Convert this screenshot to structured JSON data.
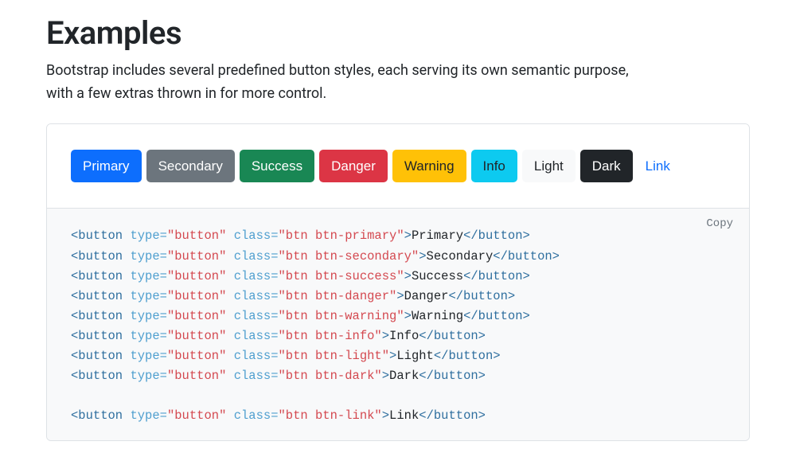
{
  "heading": "Examples",
  "intro": "Bootstrap includes several predefined button styles, each serving its own semantic purpose, with a few extras thrown in for more control.",
  "copy_label": "Copy",
  "buttons": [
    {
      "key": "primary",
      "label": "Primary",
      "class": "btn-primary",
      "bg": "#0d6efd",
      "fg": "#ffffff"
    },
    {
      "key": "secondary",
      "label": "Secondary",
      "class": "btn-secondary",
      "bg": "#6c757d",
      "fg": "#ffffff"
    },
    {
      "key": "success",
      "label": "Success",
      "class": "btn-success",
      "bg": "#198754",
      "fg": "#ffffff"
    },
    {
      "key": "danger",
      "label": "Danger",
      "class": "btn-danger",
      "bg": "#dc3545",
      "fg": "#ffffff"
    },
    {
      "key": "warning",
      "label": "Warning",
      "class": "btn-warning",
      "bg": "#ffc107",
      "fg": "#212529"
    },
    {
      "key": "info",
      "label": "Info",
      "class": "btn-info",
      "bg": "#0dcaf0",
      "fg": "#212529"
    },
    {
      "key": "light",
      "label": "Light",
      "class": "btn-light",
      "bg": "#f8f9fa",
      "fg": "#212529"
    },
    {
      "key": "dark",
      "label": "Dark",
      "class": "btn-dark",
      "bg": "#212529",
      "fg": "#ffffff"
    },
    {
      "key": "link",
      "label": "Link",
      "class": "btn-link",
      "bg": "transparent",
      "fg": "#0d6efd"
    }
  ],
  "code_lines": [
    {
      "tag": "button",
      "attrs": [
        {
          "name": "type",
          "value": "button"
        },
        {
          "name": "class",
          "value": "btn btn-primary"
        }
      ],
      "text": "Primary"
    },
    {
      "tag": "button",
      "attrs": [
        {
          "name": "type",
          "value": "button"
        },
        {
          "name": "class",
          "value": "btn btn-secondary"
        }
      ],
      "text": "Secondary"
    },
    {
      "tag": "button",
      "attrs": [
        {
          "name": "type",
          "value": "button"
        },
        {
          "name": "class",
          "value": "btn btn-success"
        }
      ],
      "text": "Success"
    },
    {
      "tag": "button",
      "attrs": [
        {
          "name": "type",
          "value": "button"
        },
        {
          "name": "class",
          "value": "btn btn-danger"
        }
      ],
      "text": "Danger"
    },
    {
      "tag": "button",
      "attrs": [
        {
          "name": "type",
          "value": "button"
        },
        {
          "name": "class",
          "value": "btn btn-warning"
        }
      ],
      "text": "Warning"
    },
    {
      "tag": "button",
      "attrs": [
        {
          "name": "type",
          "value": "button"
        },
        {
          "name": "class",
          "value": "btn btn-info"
        }
      ],
      "text": "Info"
    },
    {
      "tag": "button",
      "attrs": [
        {
          "name": "type",
          "value": "button"
        },
        {
          "name": "class",
          "value": "btn btn-light"
        }
      ],
      "text": "Light"
    },
    {
      "tag": "button",
      "attrs": [
        {
          "name": "type",
          "value": "button"
        },
        {
          "name": "class",
          "value": "btn btn-dark"
        }
      ],
      "text": "Dark"
    },
    "",
    {
      "tag": "button",
      "attrs": [
        {
          "name": "type",
          "value": "button"
        },
        {
          "name": "class",
          "value": "btn btn-link"
        }
      ],
      "text": "Link"
    }
  ]
}
